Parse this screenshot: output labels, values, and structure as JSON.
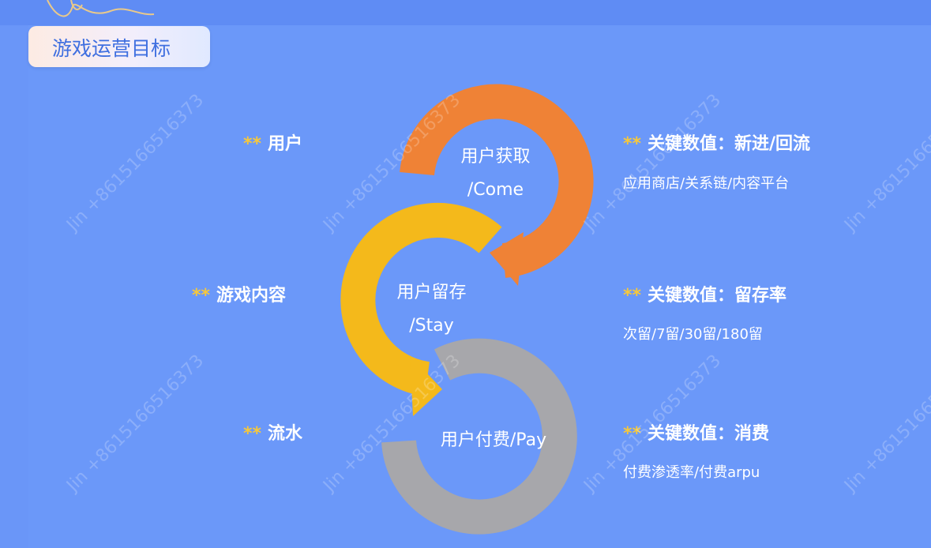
{
  "title": "游戏运营目标",
  "colors": {
    "come": "#ef8236",
    "stay": "#f4b91b",
    "pay": "#a7a7ab",
    "stars": "#f7c83b",
    "background": "#6a96f8"
  },
  "stages": [
    {
      "line1": "用户获取",
      "line2": "/Come"
    },
    {
      "line1": "用户留存",
      "line2": "/Stay"
    },
    {
      "line1": "用户付费/Pay",
      "line2": ""
    }
  ],
  "left_labels": [
    {
      "stars": "**",
      "text": "用户"
    },
    {
      "stars": "**",
      "text": "游戏内容"
    },
    {
      "stars": "**",
      "text": "流水"
    }
  ],
  "right_items": [
    {
      "stars": "**",
      "title": "关键数值：新进/回流",
      "detail": "应用商店/关系链/内容平台"
    },
    {
      "stars": "**",
      "title": "关键数值：留存率",
      "detail": "次留/7留/30留/180留"
    },
    {
      "stars": "**",
      "title": "关键数值：消费",
      "detail": "付费渗透率/付费arpu"
    }
  ],
  "watermark": "Jin +8615166516373"
}
